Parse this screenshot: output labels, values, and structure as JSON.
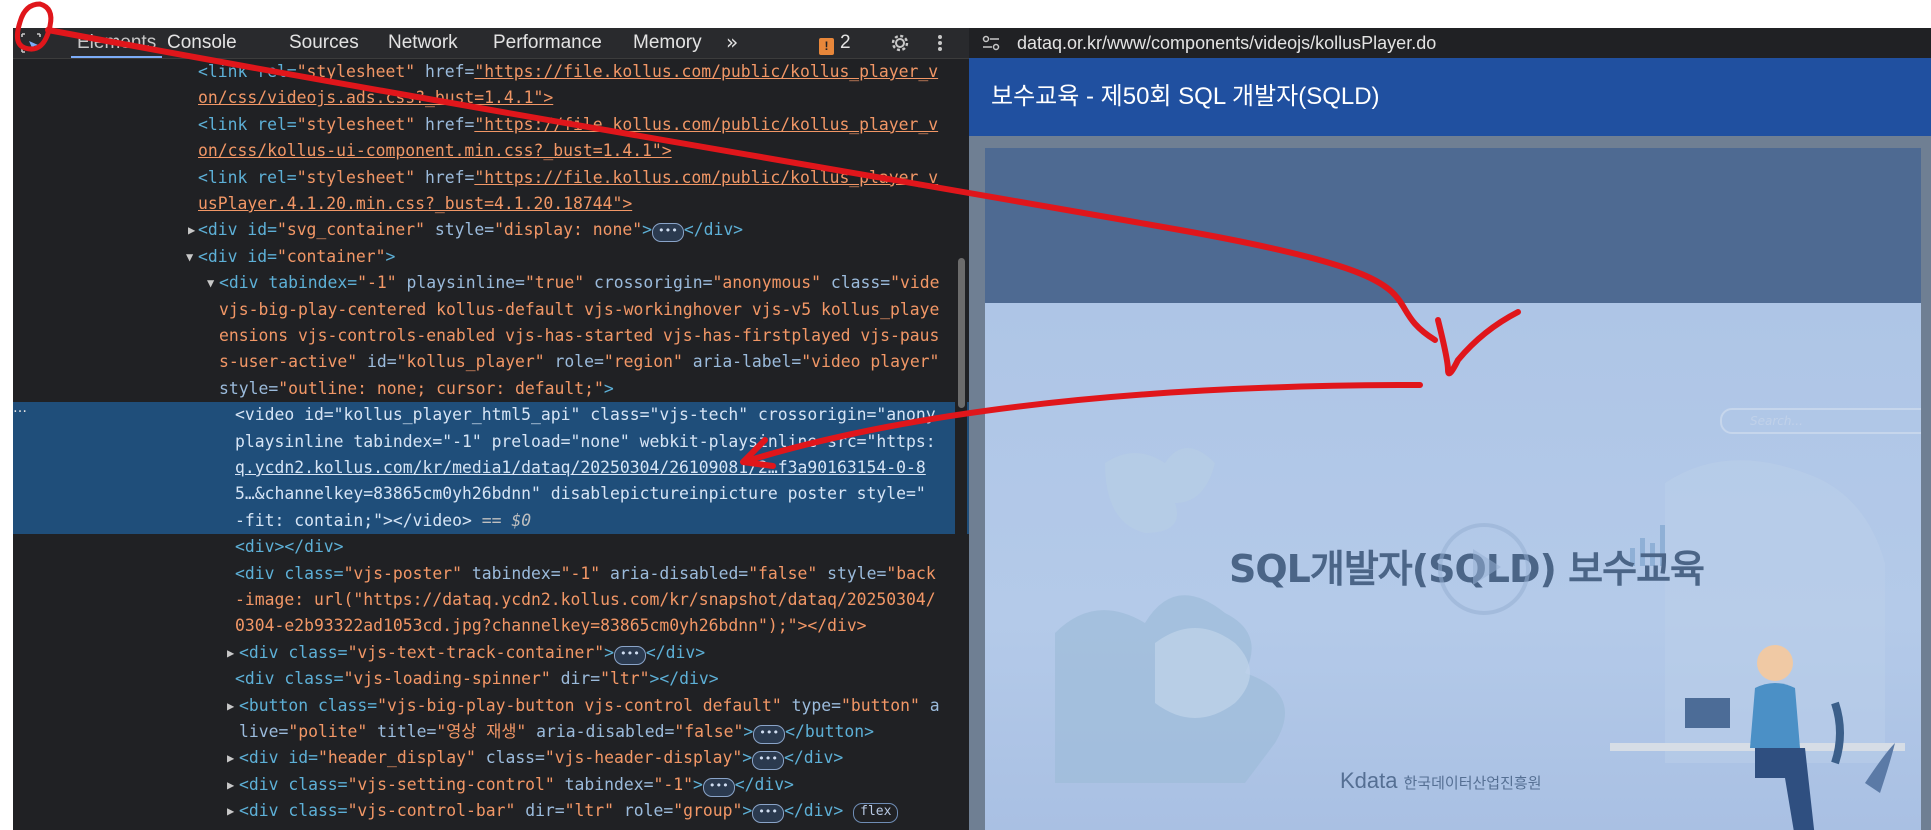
{
  "devtools": {
    "tabs": [
      "Elements",
      "Console",
      "Sources",
      "Network",
      "Performance",
      "Memory"
    ],
    "more_tabs_icon": "chevron-double-right-icon",
    "issues_count": "2",
    "settings_icon": "gear-icon",
    "menu_icon": "kebab-menu-icon",
    "selected_suffix": "== $0",
    "flex_badge": "flex",
    "ellipsis_badge": "•••",
    "lines": {
      "l01a": "<link rel=",
      "l01b": "\"stylesheet\"",
      "l01c": " href=",
      "l01d": "\"https://file.kollus.com/public/kollus_player_v",
      "l02": "on/css/videojs.ads.css?_bust=1.4.1\">",
      "l03d": "\"https://file.kollus.com/public/kollus_player_v",
      "l04": "on/css/kollus-ui-component.min.css?_bust=1.4.1\">",
      "l05d": "\"https://file.kollus.com/public/kollus_player_v",
      "l06": "usPlayer.4.1.20.min.css?_bust=4.1.20.18744\">",
      "l07a": "<div id=",
      "l07b": "\"svg_container\"",
      "l07c": " style=",
      "l07d": "\"display: none\"",
      "l07e": "</div>",
      "l08a": "<div id=",
      "l08b": "\"container\"",
      "l08c": ">",
      "l09a": "<div tabindex=",
      "l09b": "\"-1\"",
      "l09c": " playsinline=",
      "l09d": "\"true\"",
      "l09e": " crossorigin=",
      "l09f": "\"anonymous\"",
      "l09g": " class=",
      "l09h": "\"vide",
      "l10": "vjs-big-play-centered kollus-default vjs-workinghover vjs-v5 kollus_playe",
      "l11": "ensions vjs-controls-enabled vjs-has-started vjs-has-firstplayed vjs-paus",
      "l12a": "s-user-active\"",
      "l12b": " id=",
      "l12c": "\"kollus_player\"",
      "l12d": " role=",
      "l12e": "\"region\"",
      "l12f": " aria-label=",
      "l12g": "\"video player\"",
      "l13a": "style=",
      "l13b": "\"outline: none; cursor: default;\"",
      "l13c": ">",
      "l14": "<video id=\"kollus_player_html5_api\" class=\"vjs-tech\" crossorigin=\"anony",
      "l15": "playsinline tabindex=\"-1\" preload=\"none\" webkit-playsinline src=\"https:",
      "l16": "q.ycdn2.kollus.com/kr/media1/dataq/20250304/26109081/2…f3a90163154-0-8",
      "l17": "5…&channelkey=83865cm0yh26bdnn\" disablepictureinpicture poster style=\"",
      "l18": "-fit: contain;\"></video>",
      "l19": "<div></div>",
      "l20a": "<div class=",
      "l20b": "\"vjs-poster\"",
      "l20c": " tabindex=",
      "l20d": "\"-1\"",
      "l20e": " aria-disabled=",
      "l20f": "\"false\"",
      "l20g": " style=",
      "l20h": "\"back",
      "l21": "-image: url(\"https://dataq.ycdn2.kollus.com/kr/snapshot/dataq/20250304/",
      "l22": "0304-e2b93322ad1053cd.jpg?channelkey=83865cm0yh26bdnn\");\"></div>",
      "l23a": "<div class=",
      "l23b": "\"vjs-text-track-container\"",
      "l23c": "</div>",
      "l24a": "<div class=",
      "l24b": "\"vjs-loading-spinner\"",
      "l24c": " dir=",
      "l24d": "\"ltr\"",
      "l24e": "></div>",
      "l25a": "<button class=",
      "l25b": "\"vjs-big-play-button vjs-control default\"",
      "l25c": " type=",
      "l25d": "\"button\"",
      "l25e": " a",
      "l26a": "live=",
      "l26b": "\"polite\"",
      "l26c": " title=",
      "l26d": "\"영상 재생\"",
      "l26e": " aria-disabled=",
      "l26f": "\"false\"",
      "l26g": "</button>",
      "l27a": "<div id=",
      "l27b": "\"header_display\"",
      "l27c": " class=",
      "l27d": "\"vjs-header-display\"",
      "l27e": "</div>",
      "l28a": "<div class=",
      "l28b": "\"vjs-setting-control\"",
      "l28c": " tabindex=",
      "l28d": "\"-1\"",
      "l28e": "</div>",
      "l29a": "<div class=",
      "l29b": "\"vjs-control-bar\"",
      "l29c": " dir=",
      "l29d": "\"ltr\"",
      "l29e": " role=",
      "l29f": "\"group\"",
      "l29g": "</div>"
    }
  },
  "browser": {
    "url": "dataq.or.kr/www/components/videojs/kollusPlayer.do",
    "site_title": "보수교육 - 제50회 SQL 개발자(SQLD)",
    "poster_title": "SQL개발자(SQLD) 보수교육",
    "search_placeholder": "Search...",
    "kdata_logo": "Kdata",
    "kdata_org": "한국데이터산업진흥원"
  }
}
